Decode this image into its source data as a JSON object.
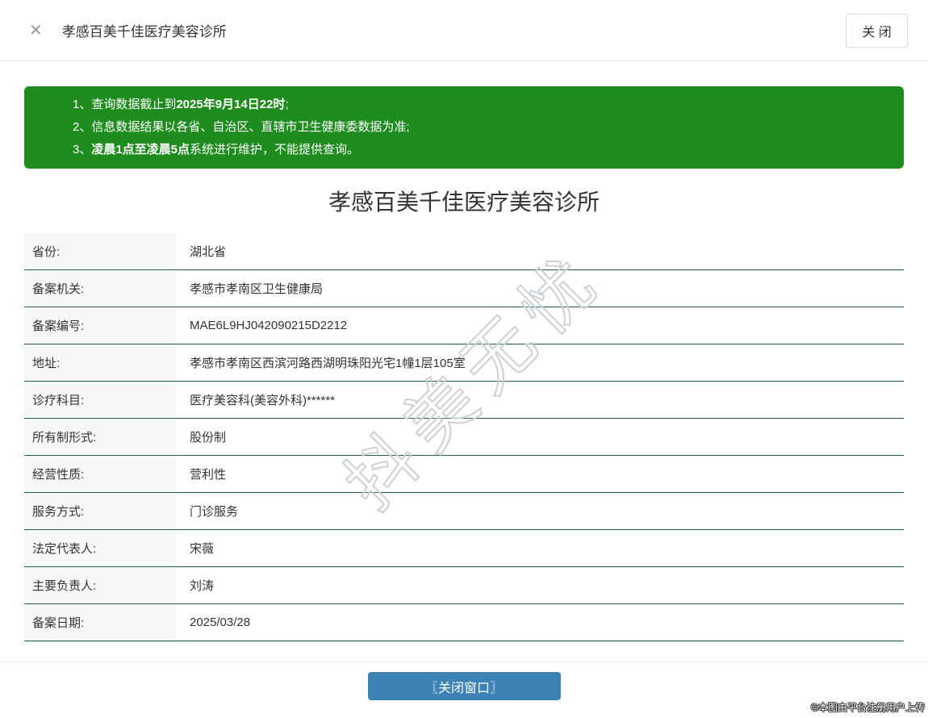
{
  "header": {
    "close_icon": "✕",
    "title": "孝感百美千佳医疗美容诊所",
    "close_button_label": "关 闭"
  },
  "notice": {
    "lines": [
      {
        "prefix": "1、查询数据截止到",
        "bold": "2025年9月14日22时",
        "suffix": ";"
      },
      {
        "prefix": "2、信息数据结果以各省、自治区、直辖市卫生健康委数据为准;",
        "bold": "",
        "suffix": ""
      },
      {
        "prefix": "3、",
        "bold": "凌晨1点至凌晨5点",
        "suffix": "系统进行维护，不能提供查询。"
      }
    ]
  },
  "main": {
    "title": "孝感百美千佳医疗美容诊所"
  },
  "table": {
    "rows": [
      {
        "label": "省份:",
        "value": "湖北省"
      },
      {
        "label": "备案机关:",
        "value": "孝感市孝南区卫生健康局"
      },
      {
        "label": "备案编号:",
        "value": "MAE6L9HJ042090215D2212"
      },
      {
        "label": "地址:",
        "value": "孝感市孝南区西滨河路西湖明珠阳光宅1幢1层105室"
      },
      {
        "label": "诊疗科目:",
        "value": "医疗美容科(美容外科)******"
      },
      {
        "label": "所有制形式:",
        "value": "股份制"
      },
      {
        "label": "经营性质:",
        "value": "营利性"
      },
      {
        "label": "服务方式:",
        "value": "门诊服务"
      },
      {
        "label": "法定代表人:",
        "value": "宋薇"
      },
      {
        "label": "主要负责人:",
        "value": "刘涛"
      },
      {
        "label": "备案日期:",
        "value": "2025/03/28"
      }
    ]
  },
  "footer": {
    "close_window_button": "〖关闭窗口〗",
    "copyright": "©本图由平台注册用户上传"
  },
  "watermark": {
    "text": "抖美无忧"
  },
  "colors": {
    "banner_green": "#1e8c1e",
    "row_border": "#215c4e",
    "button_blue": "#3c82b5",
    "label_bg": "#f6f8f8"
  }
}
